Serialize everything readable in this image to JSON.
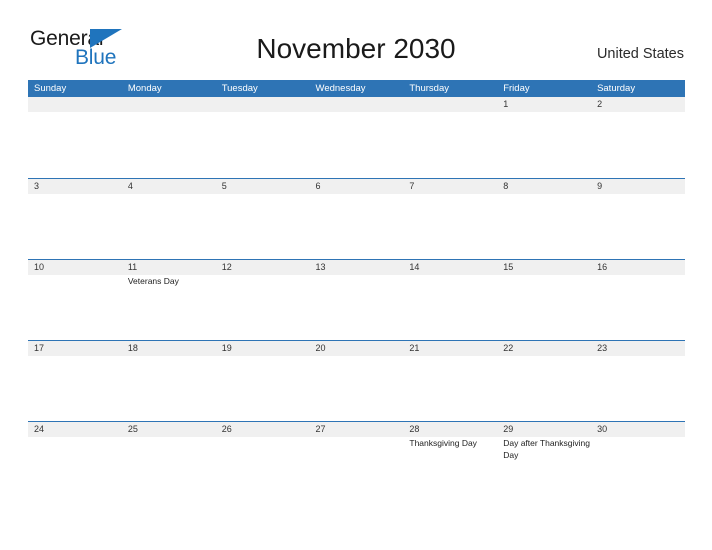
{
  "brand": {
    "name_part1": "General",
    "name_part2": "Blue",
    "flag_icon": "blue-triangle-flag-icon",
    "colors": {
      "text": "#1a1a1a",
      "blue": "#1f74bd"
    }
  },
  "header": {
    "title": "November 2030",
    "region": "United States"
  },
  "theme": {
    "header_blue": "#2e74b5",
    "row_divider_blue": "#2e74b5",
    "band_gray": "#f0f0f0",
    "page_background": "#ffffff"
  },
  "calendar": {
    "month": "November",
    "year": "2030",
    "weekday_headers": [
      "Sunday",
      "Monday",
      "Tuesday",
      "Wednesday",
      "Thursday",
      "Friday",
      "Saturday"
    ],
    "weeks": [
      {
        "days": [
          {
            "number": "",
            "events": []
          },
          {
            "number": "",
            "events": []
          },
          {
            "number": "",
            "events": []
          },
          {
            "number": "",
            "events": []
          },
          {
            "number": "",
            "events": []
          },
          {
            "number": "1",
            "events": []
          },
          {
            "number": "2",
            "events": []
          }
        ]
      },
      {
        "days": [
          {
            "number": "3",
            "events": []
          },
          {
            "number": "4",
            "events": []
          },
          {
            "number": "5",
            "events": []
          },
          {
            "number": "6",
            "events": []
          },
          {
            "number": "7",
            "events": []
          },
          {
            "number": "8",
            "events": []
          },
          {
            "number": "9",
            "events": []
          }
        ]
      },
      {
        "days": [
          {
            "number": "10",
            "events": []
          },
          {
            "number": "11",
            "events": [
              "Veterans Day"
            ]
          },
          {
            "number": "12",
            "events": []
          },
          {
            "number": "13",
            "events": []
          },
          {
            "number": "14",
            "events": []
          },
          {
            "number": "15",
            "events": []
          },
          {
            "number": "16",
            "events": []
          }
        ]
      },
      {
        "days": [
          {
            "number": "17",
            "events": []
          },
          {
            "number": "18",
            "events": []
          },
          {
            "number": "19",
            "events": []
          },
          {
            "number": "20",
            "events": []
          },
          {
            "number": "21",
            "events": []
          },
          {
            "number": "22",
            "events": []
          },
          {
            "number": "23",
            "events": []
          }
        ]
      },
      {
        "days": [
          {
            "number": "24",
            "events": []
          },
          {
            "number": "25",
            "events": []
          },
          {
            "number": "26",
            "events": []
          },
          {
            "number": "27",
            "events": []
          },
          {
            "number": "28",
            "events": [
              "Thanksgiving Day"
            ]
          },
          {
            "number": "29",
            "events": [
              "Day after Thanksgiving Day"
            ]
          },
          {
            "number": "30",
            "events": []
          }
        ]
      }
    ]
  }
}
